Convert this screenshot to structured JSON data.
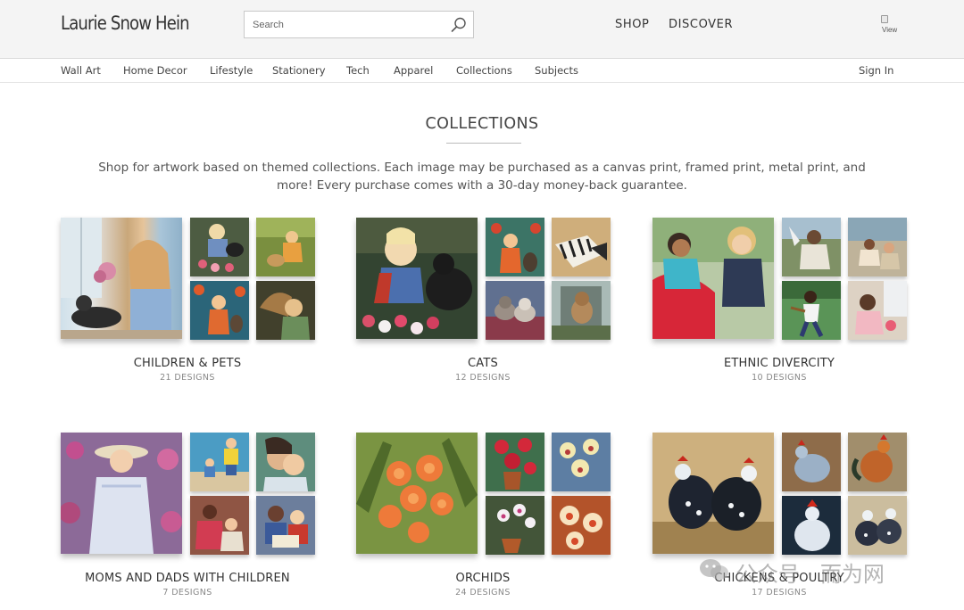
{
  "header": {
    "brand": "Laurie Snow Hein",
    "search_placeholder": "Search",
    "nav": [
      "SHOP",
      "DISCOVER"
    ],
    "cart_alt": "View"
  },
  "subnav": {
    "items": [
      "Wall Art",
      "Home Decor",
      "Lifestyle",
      "Stationery",
      "Tech",
      "Apparel",
      "Collections",
      "Subjects"
    ],
    "sign_in": "Sign In"
  },
  "main": {
    "title": "COLLECTIONS",
    "intro": "Shop for artwork based on themed collections. Each image may be purchased as a canvas print, framed print, metal print, and more! Every purchase comes with a 30-day money-back guarantee.",
    "collections": [
      {
        "name": "CHILDREN & PETS",
        "count": "21 DESIGNS"
      },
      {
        "name": "CATS",
        "count": "12 DESIGNS"
      },
      {
        "name": "ETHNIC DIVERCITY",
        "count": "10 DESIGNS"
      },
      {
        "name": "MOMS AND DADS WITH CHILDREN",
        "count": "7 DESIGNS"
      },
      {
        "name": "ORCHIDS",
        "count": "24 DESIGNS"
      },
      {
        "name": "CHICKENS & POULTRY",
        "count": "17 DESIGNS"
      }
    ]
  },
  "watermark": {
    "text": "公众号 · 而为网"
  }
}
